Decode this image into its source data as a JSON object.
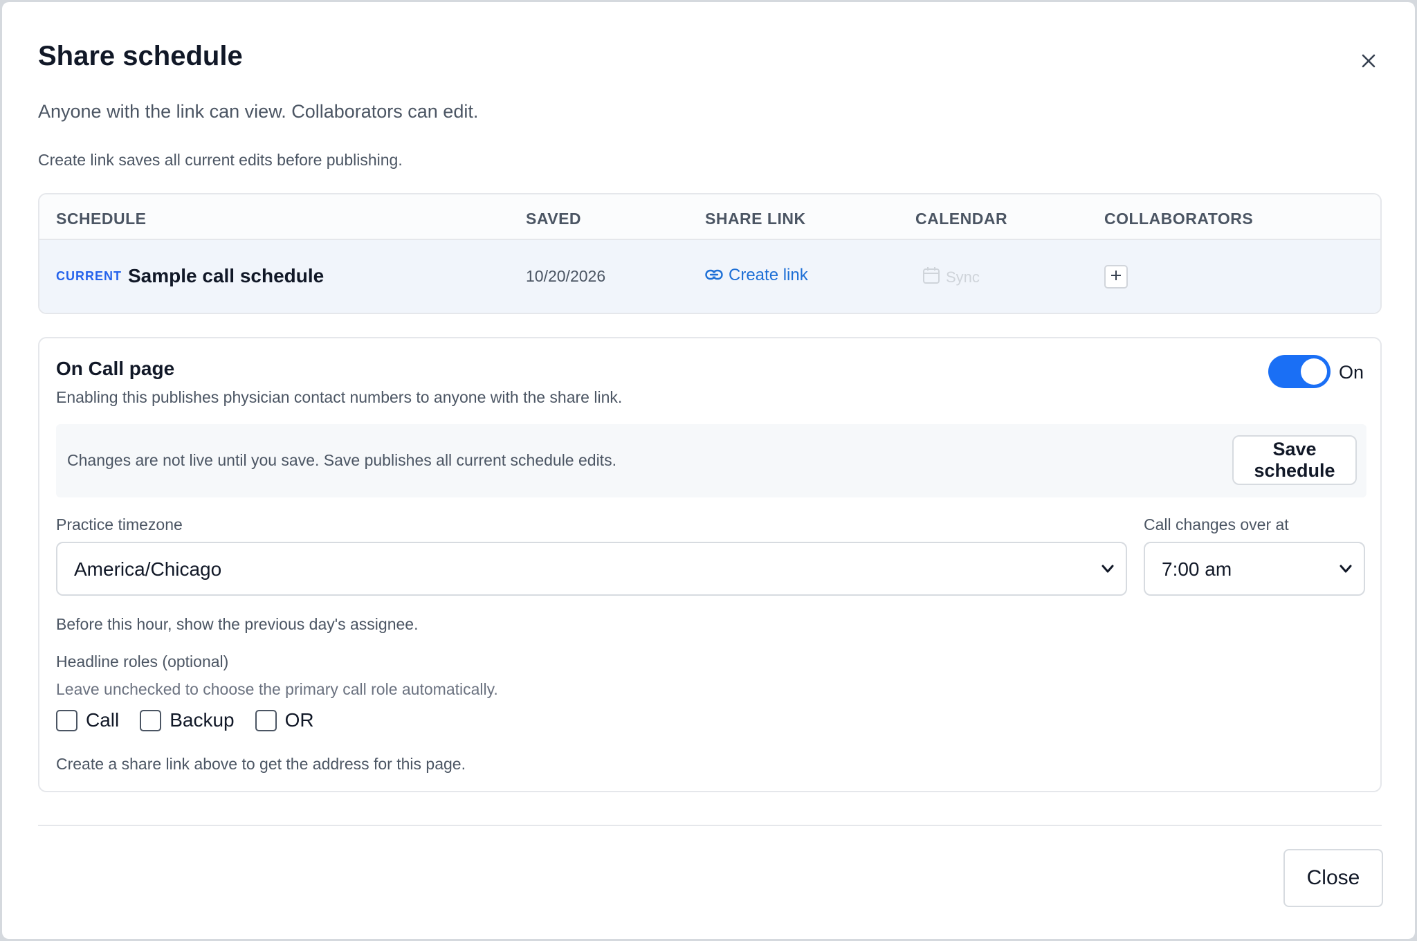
{
  "dialog": {
    "title": "Share schedule",
    "subtitle": "Anyone with the link can view. Collaborators can edit.",
    "note": "Create link saves all current edits before publishing."
  },
  "table": {
    "headers": [
      "SCHEDULE",
      "SAVED",
      "SHARE LINK",
      "CALENDAR",
      "COLLABORATORS"
    ],
    "row": {
      "badge": "CURRENT",
      "name": "Sample call schedule",
      "saved": "10/20/2026",
      "share_link_label": "Create link",
      "calendar_label": "Sync"
    }
  },
  "on_call": {
    "title": "On Call page",
    "description": "Enabling this publishes physician contact numbers to anyone with the share link.",
    "toggle_label": "On",
    "toggle_on": true,
    "info_text": "Changes are not live until you save. Save publishes all current schedule edits.",
    "save_label": "Save schedule",
    "timezone_label": "Practice timezone",
    "timezone_value": "America/Chicago",
    "changeover_label": "Call changes over at",
    "changeover_value": "7:00 am",
    "changeover_hint": "Before this hour, show the previous day's assignee.",
    "roles_label": "Headline roles (optional)",
    "roles_hint": "Leave unchecked to choose the primary call role automatically.",
    "roles": [
      "Call",
      "Backup",
      "OR"
    ],
    "footer_hint": "Create a share link above to get the address for this page."
  },
  "footer": {
    "close_label": "Close"
  },
  "colors": {
    "accent": "#1a6ff5",
    "link": "#1d6fd6",
    "row_highlight": "#f1f5fb"
  },
  "icons": [
    "close-icon",
    "link-icon",
    "calendar-icon",
    "plus-icon",
    "chevron-down-icon"
  ]
}
